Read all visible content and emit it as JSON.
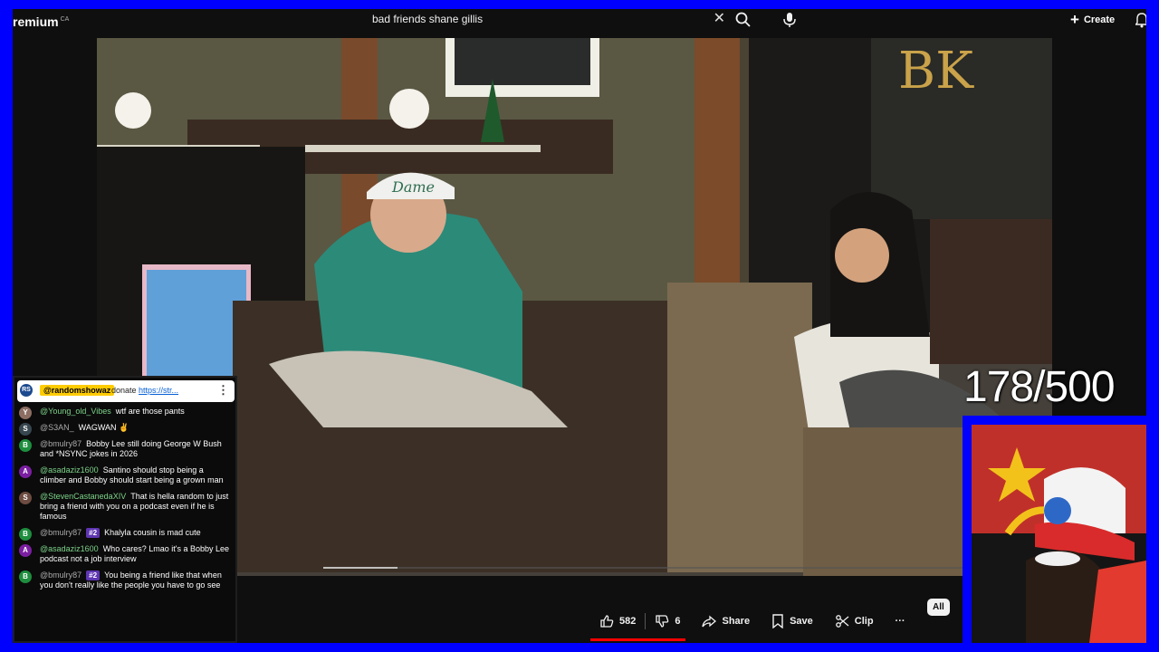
{
  "header": {
    "brand": "remium",
    "brand_sup": "CA",
    "search_query": "bad friends shane gillis",
    "create_label": "Create"
  },
  "counter": "178/500",
  "chat": {
    "pinned": {
      "avatar_initials": "RS",
      "author": "@randomshowaz",
      "text": "donate",
      "link": "https://str..."
    },
    "messages": [
      {
        "avatar": "Y",
        "avatar_color": "#8d6e63",
        "author": "@Young_old_Vibes",
        "author_color": "green",
        "badge": "",
        "text": "wtf are those pants"
      },
      {
        "avatar": "S",
        "avatar_color": "#37474f",
        "author": "@S3AN_",
        "author_color": "default",
        "badge": "",
        "text": "WAGWAN ✌️"
      },
      {
        "avatar": "B",
        "avatar_color": "#1e8e3e",
        "author": "@bmulry87",
        "author_color": "default",
        "badge": "",
        "text": "Bobby Lee still doing George W Bush and *NSYNC jokes in 2026"
      },
      {
        "avatar": "A",
        "avatar_color": "#7b1fa2",
        "author": "@asadaziz1600",
        "author_color": "green",
        "badge": "",
        "text": "Santino should stop being a climber and Bobby should start being a grown man"
      },
      {
        "avatar": "S",
        "avatar_color": "#6d4c41",
        "author": "@StevenCastanedaXIV",
        "author_color": "green",
        "badge": "",
        "text": "That is hella random to just bring a friend with you on a podcast even if he is famous"
      },
      {
        "avatar": "B",
        "avatar_color": "#1e8e3e",
        "author": "@bmulry87",
        "author_color": "default",
        "badge": "#2",
        "text": "Khalyla cousin is mad cute"
      },
      {
        "avatar": "A",
        "avatar_color": "#7b1fa2",
        "author": "@asadaziz1600",
        "author_color": "green",
        "badge": "",
        "text": "Who cares? Lmao it's a Bobby Lee podcast not a job interview"
      },
      {
        "avatar": "B",
        "avatar_color": "#1e8e3e",
        "author": "@bmulry87",
        "author_color": "default",
        "badge": "#2",
        "text": "You being a friend like that when you don't really like the people you have to go see"
      }
    ]
  },
  "actions": {
    "likes": "582",
    "dislikes": "6",
    "share": "Share",
    "save": "Save",
    "clip": "Clip",
    "more": "···",
    "chip_all": "All"
  },
  "video": {
    "sign_text": "BK",
    "cap_text": "Dame"
  }
}
